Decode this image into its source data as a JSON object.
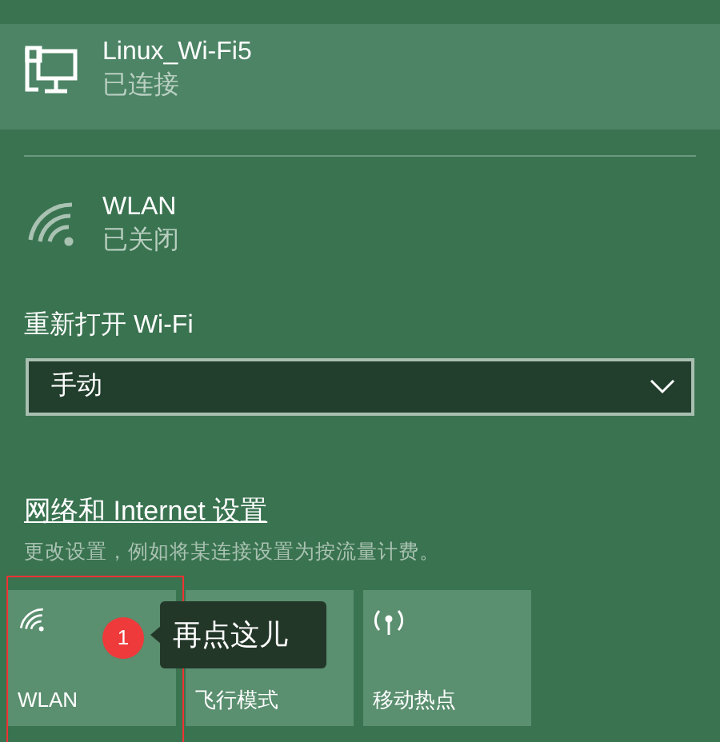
{
  "connections": [
    {
      "name": "Linux_Wi-Fi5",
      "status": "已连接",
      "kind": "wired",
      "selected": true
    },
    {
      "name": "WLAN",
      "status": "已关闭",
      "kind": "wifi",
      "selected": false
    }
  ],
  "reopen": {
    "label": "重新打开 Wi-Fi",
    "value": "手动"
  },
  "settings_link": "网络和 Internet 设置",
  "settings_hint": "更改设置，例如将某连接设置为按流量计费。",
  "tiles": [
    {
      "label": "WLAN",
      "kind": "wifi"
    },
    {
      "label": "飞行模式",
      "kind": "airplane"
    },
    {
      "label": "移动热点",
      "kind": "hotspot"
    }
  ],
  "annotation": {
    "badge": "1",
    "text": "再点这儿"
  }
}
